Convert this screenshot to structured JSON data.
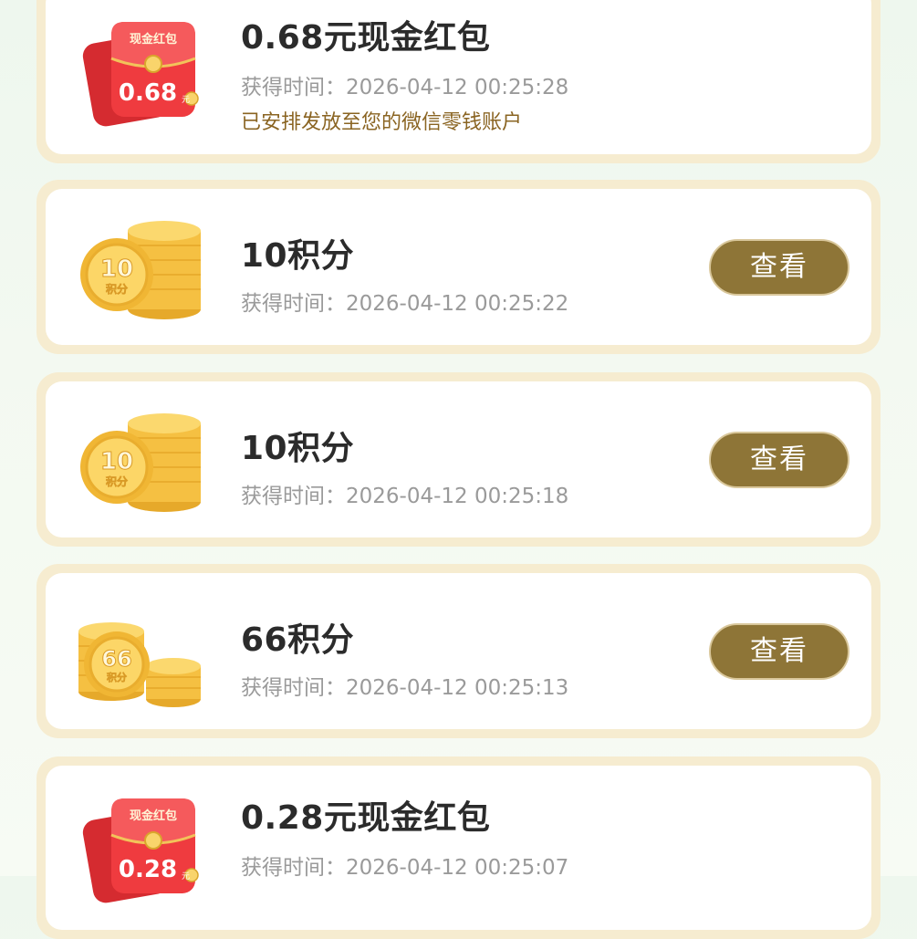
{
  "records": [
    {
      "type": "red-packet",
      "icon": "red-packet-icon",
      "icon_caption": "现金红包",
      "icon_amount": "0.68",
      "icon_unit": "元",
      "title": "0.68元现金红包",
      "time": "获得时间：2026-04-12 00:25:28",
      "note": "已安排发放至您的微信零钱账户"
    },
    {
      "type": "points",
      "icon": "coin-stack-icon",
      "icon_amount": "10",
      "icon_unit": "积分",
      "title": "10积分",
      "time": "获得时间：2026-04-12 00:25:22",
      "button": "查看"
    },
    {
      "type": "points",
      "icon": "coin-stack-icon",
      "icon_amount": "10",
      "icon_unit": "积分",
      "title": "10积分",
      "time": "获得时间：2026-04-12 00:25:18",
      "button": "查看"
    },
    {
      "type": "points",
      "icon": "coin-stack-icon",
      "icon_amount": "66",
      "icon_unit": "积分",
      "title": "66积分",
      "time": "获得时间：2026-04-12 00:25:13",
      "button": "查看"
    },
    {
      "type": "red-packet",
      "icon": "red-packet-icon",
      "icon_caption": "现金红包",
      "icon_amount": "0.28",
      "icon_unit": "元",
      "title": "0.28元现金红包",
      "time": "获得时间：2026-04-12 00:25:07"
    }
  ],
  "colors": {
    "card_border": "#f6ecd0",
    "button_bg": "#8e7537",
    "note_text": "#8a6422",
    "red_packet": "#e8333a",
    "coin_gold": "#f5c042"
  }
}
